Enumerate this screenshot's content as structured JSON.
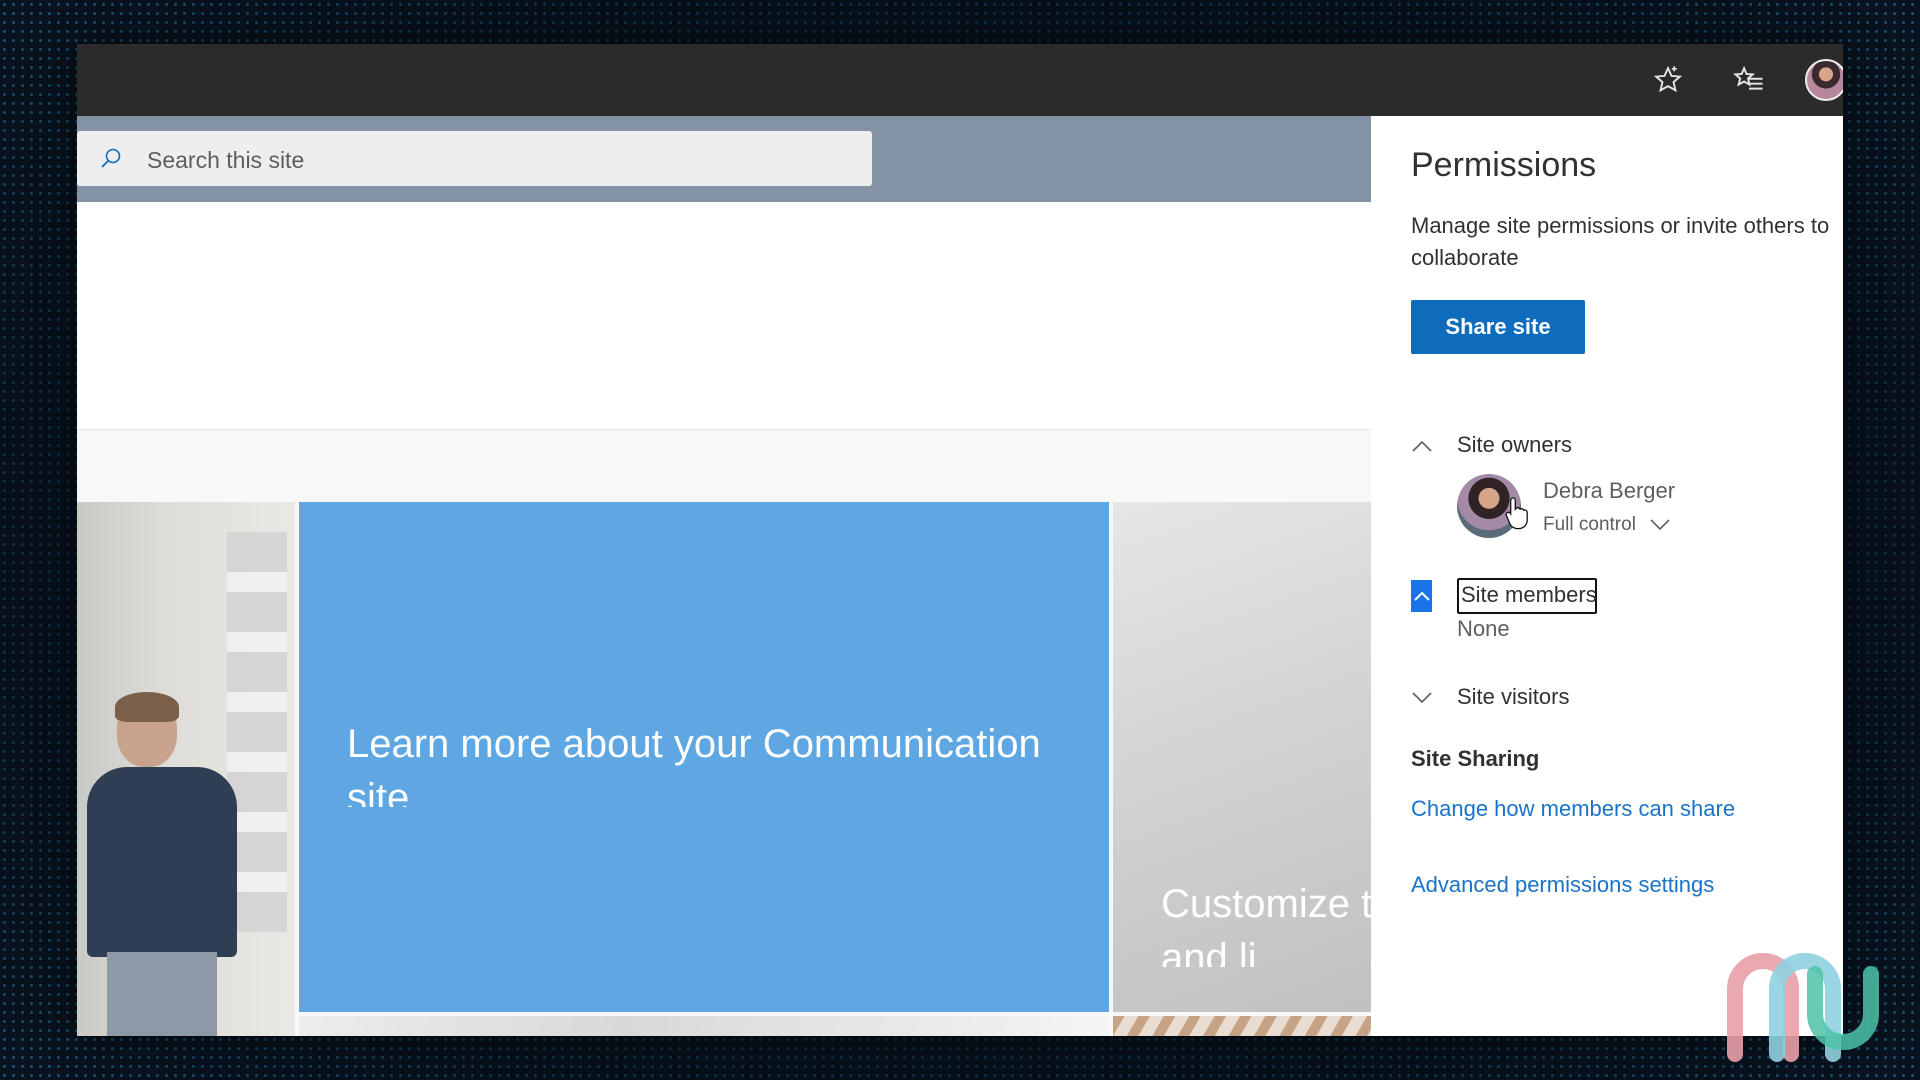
{
  "search": {
    "placeholder": "Search this site"
  },
  "toolbar": {
    "favorite_icon": "star-outline-icon",
    "favorites_list_icon": "star-list-icon",
    "profile_icon": "avatar"
  },
  "tiles": {
    "main_title": "Learn more about your Communication site",
    "right_title": "Customize this image and li"
  },
  "panel": {
    "title": "Permissions",
    "description": "Manage site permissions or invite others to collaborate",
    "share_button": "Share site",
    "owners": {
      "label": "Site owners",
      "person_name": "Debra Berger",
      "person_role": "Full control"
    },
    "members": {
      "label": "Site members",
      "value": "None"
    },
    "visitors": {
      "label": "Site visitors"
    },
    "sharing": {
      "heading": "Site Sharing",
      "change_link": "Change how members can share",
      "advanced_link": "Advanced permissions settings"
    }
  },
  "colors": {
    "accent": "#0f6cbd",
    "link": "#1a73c8",
    "tile_blue": "#5ea7e3",
    "header": "#8492a6",
    "topbar": "#2b2b2b"
  }
}
